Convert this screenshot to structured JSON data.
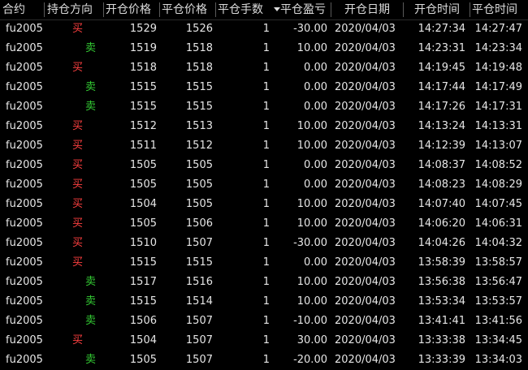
{
  "header": {
    "contract": "合约",
    "direction": "持仓方向",
    "open_price": "开仓价格",
    "close_price": "平仓价格",
    "close_qty": "平仓手数",
    "close_pnl": "平仓盈亏",
    "open_date": "开仓日期",
    "open_time": "开仓时间",
    "close_time": "平仓时间"
  },
  "colors": {
    "buy": "#ff4040",
    "sell": "#33cc33",
    "text": "#e6e6e6",
    "background": "#000000"
  },
  "rows": [
    {
      "contract": "fu2005",
      "direction": "买",
      "side": "buy",
      "open_price": "1529",
      "close_price": "1526",
      "qty": "1",
      "pnl": "-30.00",
      "open_date": "2020/04/03",
      "open_time": "14:27:34",
      "close_time": "14:27:47"
    },
    {
      "contract": "fu2005",
      "direction": "卖",
      "side": "sell",
      "open_price": "1519",
      "close_price": "1518",
      "qty": "1",
      "pnl": "10.00",
      "open_date": "2020/04/03",
      "open_time": "14:23:31",
      "close_time": "14:23:34"
    },
    {
      "contract": "fu2005",
      "direction": "买",
      "side": "buy",
      "open_price": "1518",
      "close_price": "1518",
      "qty": "1",
      "pnl": "0.00",
      "open_date": "2020/04/03",
      "open_time": "14:19:45",
      "close_time": "14:19:48"
    },
    {
      "contract": "fu2005",
      "direction": "卖",
      "side": "sell",
      "open_price": "1515",
      "close_price": "1515",
      "qty": "1",
      "pnl": "0.00",
      "open_date": "2020/04/03",
      "open_time": "14:17:44",
      "close_time": "14:17:49"
    },
    {
      "contract": "fu2005",
      "direction": "卖",
      "side": "sell",
      "open_price": "1515",
      "close_price": "1515",
      "qty": "1",
      "pnl": "0.00",
      "open_date": "2020/04/03",
      "open_time": "14:17:26",
      "close_time": "14:17:31"
    },
    {
      "contract": "fu2005",
      "direction": "买",
      "side": "buy",
      "open_price": "1512",
      "close_price": "1513",
      "qty": "1",
      "pnl": "10.00",
      "open_date": "2020/04/03",
      "open_time": "14:13:24",
      "close_time": "14:13:31"
    },
    {
      "contract": "fu2005",
      "direction": "买",
      "side": "buy",
      "open_price": "1511",
      "close_price": "1512",
      "qty": "1",
      "pnl": "10.00",
      "open_date": "2020/04/03",
      "open_time": "14:12:39",
      "close_time": "14:13:07"
    },
    {
      "contract": "fu2005",
      "direction": "买",
      "side": "buy",
      "open_price": "1505",
      "close_price": "1505",
      "qty": "1",
      "pnl": "0.00",
      "open_date": "2020/04/03",
      "open_time": "14:08:37",
      "close_time": "14:08:52"
    },
    {
      "contract": "fu2005",
      "direction": "买",
      "side": "buy",
      "open_price": "1505",
      "close_price": "1505",
      "qty": "1",
      "pnl": "0.00",
      "open_date": "2020/04/03",
      "open_time": "14:08:23",
      "close_time": "14:08:29"
    },
    {
      "contract": "fu2005",
      "direction": "买",
      "side": "buy",
      "open_price": "1504",
      "close_price": "1505",
      "qty": "1",
      "pnl": "10.00",
      "open_date": "2020/04/03",
      "open_time": "14:07:40",
      "close_time": "14:07:45"
    },
    {
      "contract": "fu2005",
      "direction": "买",
      "side": "buy",
      "open_price": "1505",
      "close_price": "1506",
      "qty": "1",
      "pnl": "10.00",
      "open_date": "2020/04/03",
      "open_time": "14:06:20",
      "close_time": "14:06:31"
    },
    {
      "contract": "fu2005",
      "direction": "买",
      "side": "buy",
      "open_price": "1510",
      "close_price": "1507",
      "qty": "1",
      "pnl": "-30.00",
      "open_date": "2020/04/03",
      "open_time": "14:04:26",
      "close_time": "14:04:32"
    },
    {
      "contract": "fu2005",
      "direction": "买",
      "side": "buy",
      "open_price": "1515",
      "close_price": "1515",
      "qty": "1",
      "pnl": "0.00",
      "open_date": "2020/04/03",
      "open_time": "13:58:39",
      "close_time": "13:58:57"
    },
    {
      "contract": "fu2005",
      "direction": "卖",
      "side": "sell",
      "open_price": "1517",
      "close_price": "1516",
      "qty": "1",
      "pnl": "10.00",
      "open_date": "2020/04/03",
      "open_time": "13:56:38",
      "close_time": "13:56:47"
    },
    {
      "contract": "fu2005",
      "direction": "卖",
      "side": "sell",
      "open_price": "1515",
      "close_price": "1514",
      "qty": "1",
      "pnl": "10.00",
      "open_date": "2020/04/03",
      "open_time": "13:53:34",
      "close_time": "13:53:57"
    },
    {
      "contract": "fu2005",
      "direction": "卖",
      "side": "sell",
      "open_price": "1506",
      "close_price": "1507",
      "qty": "1",
      "pnl": "-10.00",
      "open_date": "2020/04/03",
      "open_time": "13:41:41",
      "close_time": "13:41:56"
    },
    {
      "contract": "fu2005",
      "direction": "买",
      "side": "buy",
      "open_price": "1504",
      "close_price": "1507",
      "qty": "1",
      "pnl": "30.00",
      "open_date": "2020/04/03",
      "open_time": "13:33:38",
      "close_time": "13:34:45"
    },
    {
      "contract": "fu2005",
      "direction": "卖",
      "side": "sell",
      "open_price": "1505",
      "close_price": "1507",
      "qty": "1",
      "pnl": "-20.00",
      "open_date": "2020/04/03",
      "open_time": "13:33:39",
      "close_time": "13:34:03"
    }
  ]
}
